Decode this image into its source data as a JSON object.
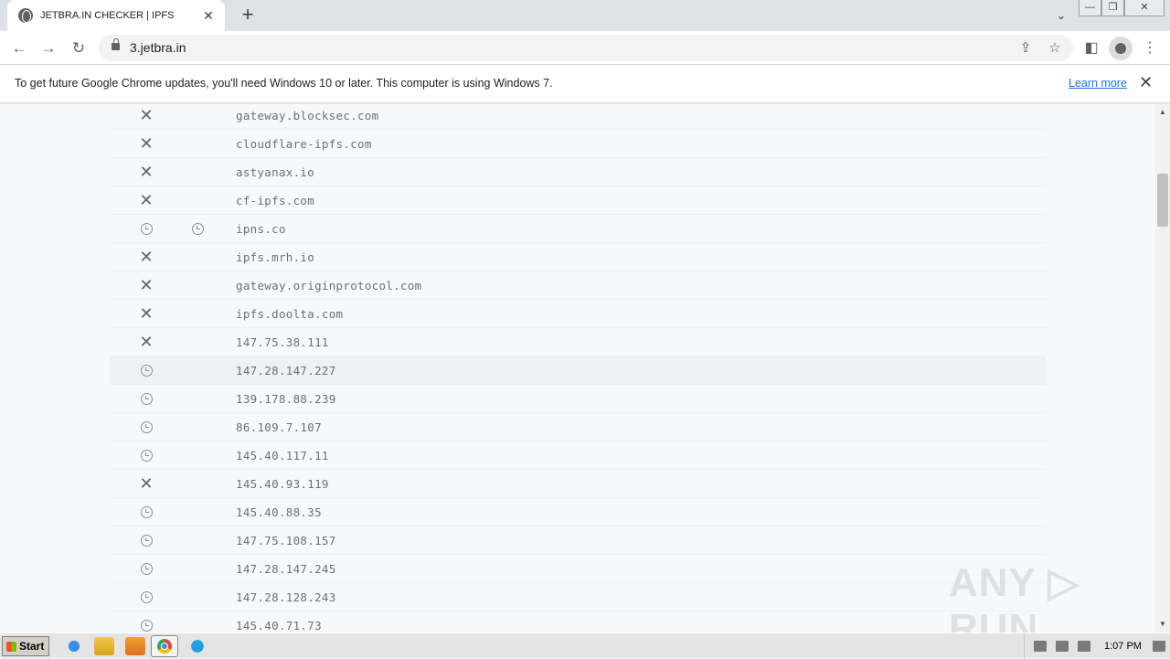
{
  "browser": {
    "tab_title": "JETBRA.IN CHECKER | IPFS",
    "tab_close": "✕",
    "new_tab": "+",
    "tab_search": "⌄",
    "window_minimize": "—",
    "window_restore": "❐",
    "window_close": "✕",
    "url": "3.jetbra.in",
    "back": "←",
    "forward": "→",
    "reload": "↻",
    "share_icon": "⇪",
    "star_icon": "☆",
    "sidepanel_icon": "◧",
    "menu_icon": "⋮"
  },
  "infobar": {
    "message": "To get future Google Chrome updates, you'll need Windows 10 or later. This computer is using Windows 7.",
    "learn_more": "Learn more",
    "close": "✕"
  },
  "rows": [
    {
      "status": "failed",
      "host": "gateway.blocksec.com"
    },
    {
      "status": "failed",
      "host": "cloudflare-ipfs.com"
    },
    {
      "status": "failed",
      "host": "astyanax.io"
    },
    {
      "status": "failed",
      "host": "cf-ipfs.com"
    },
    {
      "status": "pending",
      "status2": "pending",
      "host": "ipns.co"
    },
    {
      "status": "failed",
      "host": "ipfs.mrh.io"
    },
    {
      "status": "failed",
      "host": "gateway.originprotocol.com"
    },
    {
      "status": "failed",
      "host": "ipfs.doolta.com"
    },
    {
      "status": "failed",
      "host": "147.75.38.111"
    },
    {
      "status": "pending",
      "host": "147.28.147.227",
      "highlight": true
    },
    {
      "status": "pending",
      "host": "139.178.88.239"
    },
    {
      "status": "pending",
      "host": "86.109.7.107"
    },
    {
      "status": "pending",
      "host": "145.40.117.11"
    },
    {
      "status": "failed",
      "host": "145.40.93.119"
    },
    {
      "status": "pending",
      "host": "145.40.88.35"
    },
    {
      "status": "pending",
      "host": "147.75.108.157"
    },
    {
      "status": "pending",
      "host": "147.28.147.245"
    },
    {
      "status": "pending",
      "host": "147.28.128.243"
    },
    {
      "status": "pending",
      "host": "145.40.71.73"
    }
  ],
  "watermark": "ANY ▷ RUN",
  "taskbar": {
    "start": "Start",
    "time": "1:07 PM"
  }
}
